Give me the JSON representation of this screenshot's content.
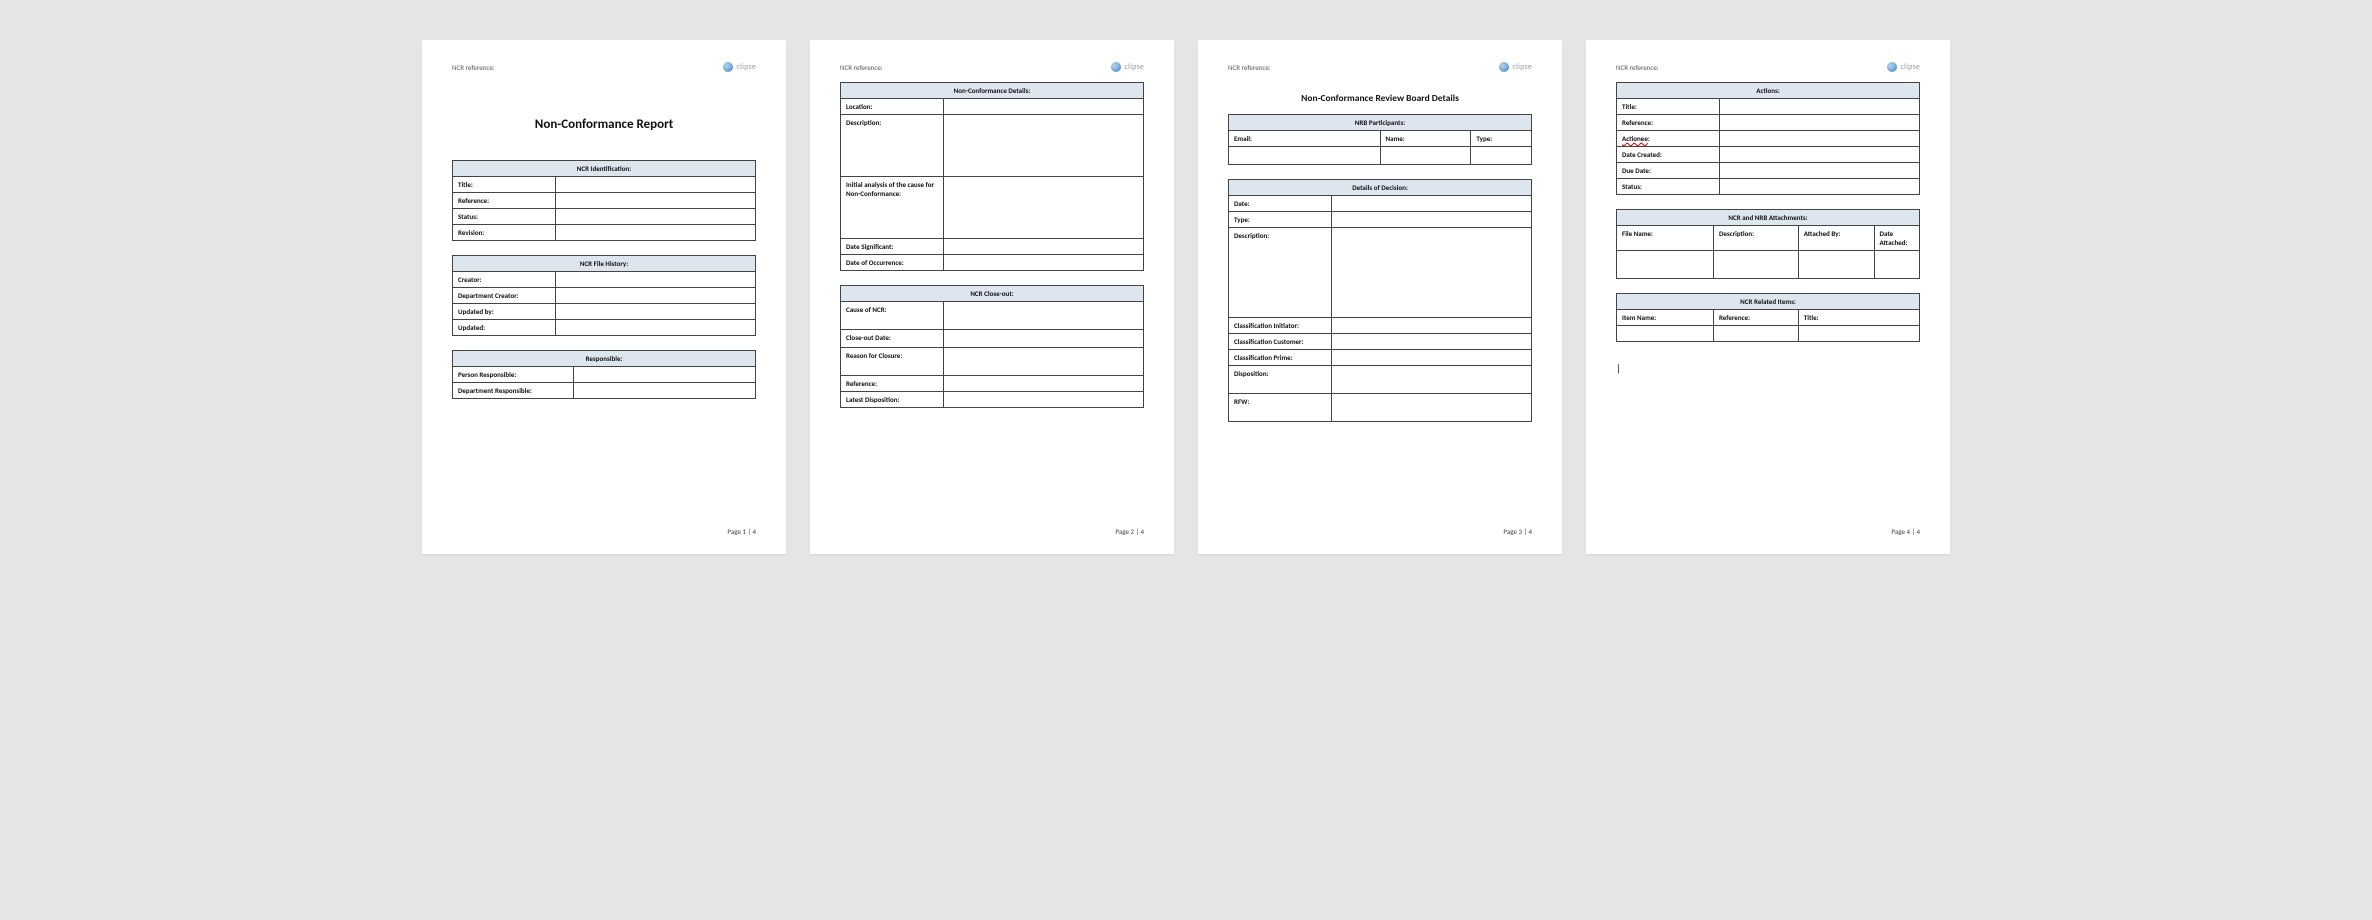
{
  "header": {
    "ref_label": "NCR reference:",
    "logo_text": "clipse"
  },
  "page1": {
    "title": "Non-Conformance Report",
    "ncr_id": {
      "section": "NCR Identification:",
      "rows": [
        "Title:",
        "Reference:",
        "Status:",
        "Revision:"
      ]
    },
    "file_history": {
      "section": "NCR File History:",
      "rows": [
        "Creator:",
        "Department Creator:",
        "Updated by:",
        "Updated:"
      ]
    },
    "responsible": {
      "section": "Responsible:",
      "rows": [
        "Person Responsible:",
        "Department Responsible:"
      ]
    },
    "footer": "Page 1 | 4"
  },
  "page2": {
    "details": {
      "section": "Non-Conformance Details:",
      "rows": [
        "Location:",
        "Description:",
        "Initial analysis of the cause for Non-Conformance:",
        "Date Significant:",
        "Date of Occurrence:"
      ]
    },
    "closeout": {
      "section": "NCR Close-out:",
      "rows": [
        "Cause of NCR:",
        "Close-out Date:",
        "Reason for Closure:",
        "Reference:",
        "Latest Disposition:"
      ]
    },
    "footer": "Page 2 | 4"
  },
  "page3": {
    "title": "Non-Conformance Review Board Details",
    "participants": {
      "section": "NRB Participants:",
      "cols": [
        "Email:",
        "Name:",
        "Type:"
      ]
    },
    "decision": {
      "section": "Details of Decision:",
      "rows": [
        "Date:",
        "Type:",
        "Description:",
        "Classification Initiator:",
        "Classification Customer:",
        "Classification Prime:",
        "Disposition:",
        "RFW:"
      ]
    },
    "footer": "Page 3 | 4"
  },
  "page4": {
    "actions": {
      "section": "Actions:",
      "rows": [
        "Title:",
        "Reference:",
        "Actionee",
        "Date Created:",
        "Due Date:",
        "Status:"
      ],
      "squiggle_suffix": ":"
    },
    "attachments": {
      "section": "NCR and NRB Attachments:",
      "cols": [
        "File Name:",
        "Description:",
        "Attached By:",
        "Date Attached:"
      ]
    },
    "related": {
      "section": "NCR Related Items:",
      "cols": [
        "Item Name:",
        "Reference:",
        "Title:"
      ]
    },
    "cursor": "|",
    "footer": "Page 4 | 4"
  }
}
